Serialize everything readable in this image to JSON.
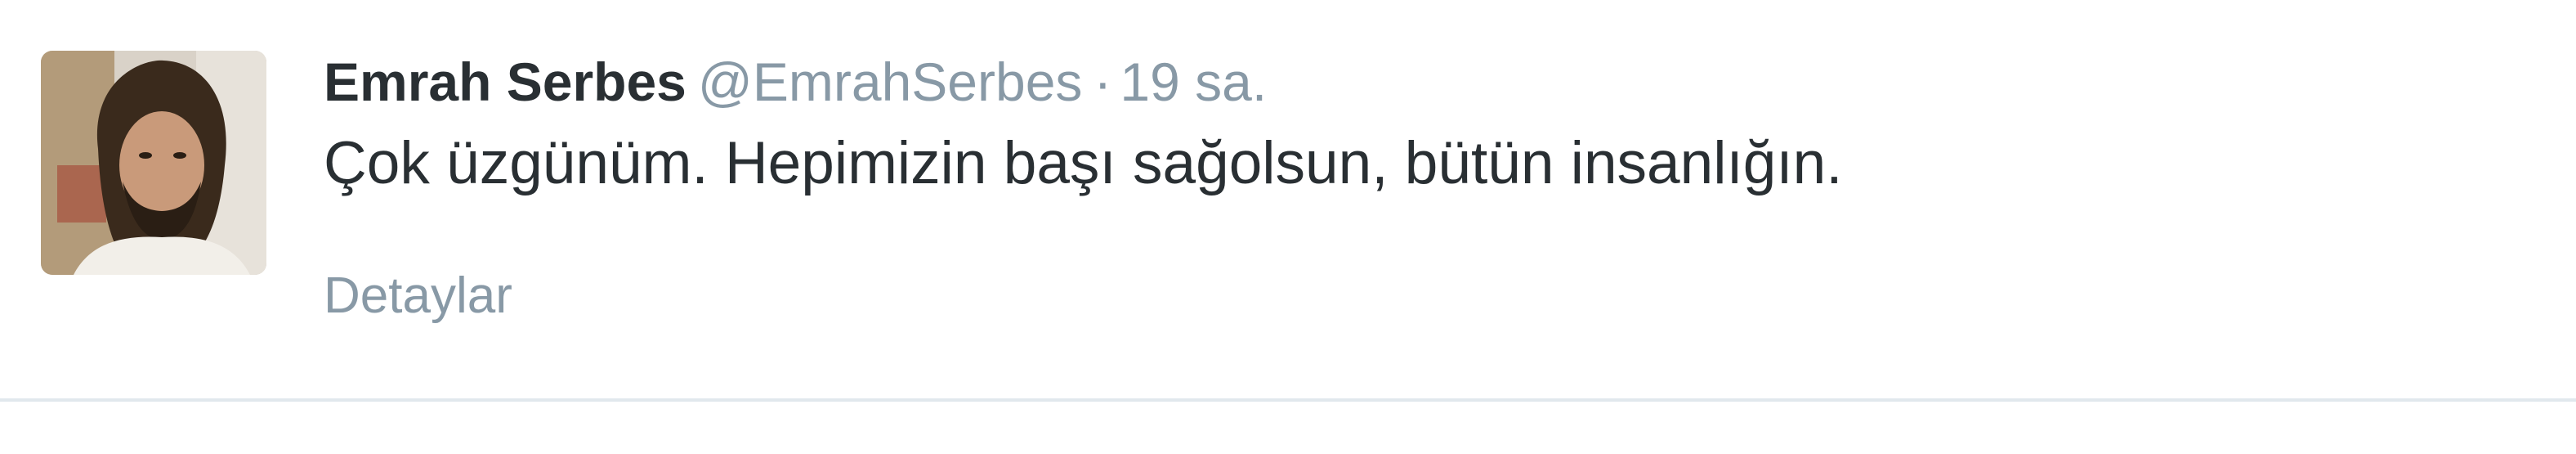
{
  "tweet": {
    "fullname": "Emrah Serbes",
    "username": "@EmrahSerbes",
    "separator": "·",
    "time": "19 sa.",
    "text": "Çok üzgünüm. Hepimizin başı sağolsun, bütün insanlığın.",
    "details_label": "Detaylar",
    "avatar": "profile-photo"
  },
  "colors": {
    "name": "#292f33",
    "meta": "#8899a6",
    "text": "#292f33",
    "divider": "#e1e8ed"
  }
}
